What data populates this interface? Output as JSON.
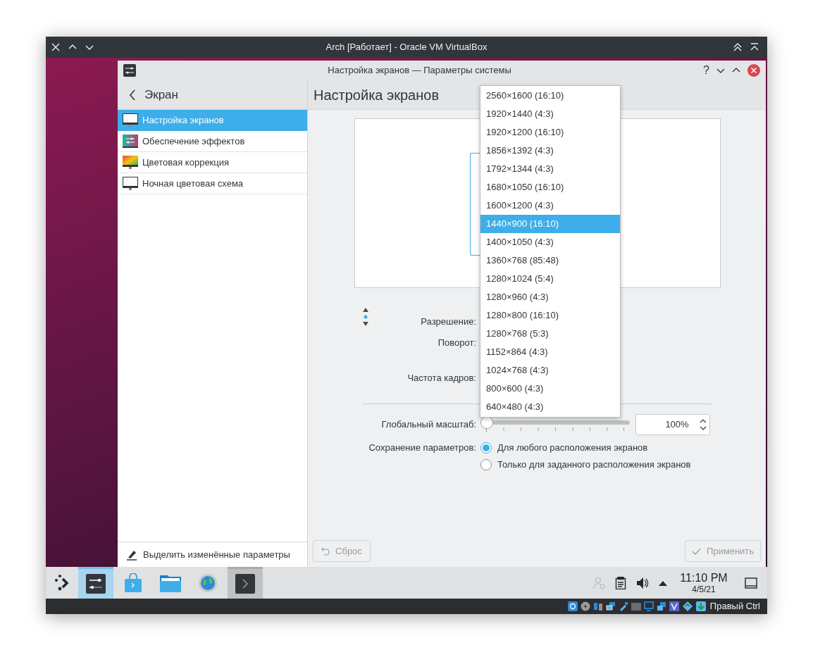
{
  "vbox_window": {
    "title": "Arch [Работает] - Oracle VM VirtualBox"
  },
  "settings_window": {
    "title": "Настройка экранов — Параметры системы",
    "help": "?"
  },
  "sidebar": {
    "back_label": "Экран",
    "items": [
      {
        "label": "Настройка экранов",
        "kind": "monitor",
        "selected": true
      },
      {
        "label": "Обеспечение эффектов",
        "kind": "effects",
        "selected": false
      },
      {
        "label": "Цветовая коррекция",
        "kind": "color",
        "selected": false
      },
      {
        "label": "Ночная цветовая схема",
        "kind": "monitor",
        "selected": false
      }
    ],
    "highlight_button": "Выделить изменённые параметры"
  },
  "page": {
    "title": "Настройка экранов",
    "form": {
      "resolution_label": "Разрешение:",
      "rotation_label": "Поворот:",
      "refresh_label": "Частота кадров:"
    },
    "scale": {
      "label": "Глобальный масштаб:",
      "level": 0,
      "reading": "100%"
    },
    "save": {
      "label": "Сохранение параметров:",
      "options": [
        {
          "label": "Для любого расположения экранов",
          "selected": true
        },
        {
          "label": "Только для заданного расположения экранов",
          "selected": false
        }
      ]
    },
    "reset_button": {
      "label": "Сброс",
      "disabled": true
    },
    "apply_button": {
      "label": "Применить",
      "disabled": true
    }
  },
  "resolution_dropdown": [
    {
      "label": "2560×1600 (16:10)",
      "selected": false
    },
    {
      "label": "1920×1440 (4:3)",
      "selected": false
    },
    {
      "label": "1920×1200 (16:10)",
      "selected": false
    },
    {
      "label": "1856×1392 (4:3)",
      "selected": false
    },
    {
      "label": "1792×1344 (4:3)",
      "selected": false
    },
    {
      "label": "1680×1050 (16:10)",
      "selected": false
    },
    {
      "label": "1600×1200 (4:3)",
      "selected": false
    },
    {
      "label": "1440×900 (16:10)",
      "selected": true
    },
    {
      "label": "1400×1050 (4:3)",
      "selected": false
    },
    {
      "label": "1360×768 (85:48)",
      "selected": false
    },
    {
      "label": "1280×1024 (5:4)",
      "selected": false
    },
    {
      "label": "1280×960 (4:3)",
      "selected": false
    },
    {
      "label": "1280×800 (16:10)",
      "selected": false
    },
    {
      "label": "1280×768 (5:3)",
      "selected": false
    },
    {
      "label": "1152×864 (4:3)",
      "selected": false
    },
    {
      "label": "1024×768 (4:3)",
      "selected": false
    },
    {
      "label": "800×600 (4:3)",
      "selected": false
    },
    {
      "label": "640×480 (4:3)",
      "selected": false
    }
  ],
  "taskbar": {
    "tasks": [
      {
        "kind": "sliders",
        "selected": true,
        "hovered": false
      },
      {
        "kind": "bag",
        "selected": false,
        "hovered": false
      },
      {
        "kind": "folder",
        "selected": false,
        "hovered": false
      },
      {
        "kind": "globe",
        "selected": false,
        "hovered": false
      },
      {
        "kind": "terminal",
        "selected": false,
        "hovered": true
      }
    ],
    "time": "11:10 PM",
    "date": "4/5/21"
  },
  "vbox_status": {
    "host_key": "Правый Ctrl"
  }
}
